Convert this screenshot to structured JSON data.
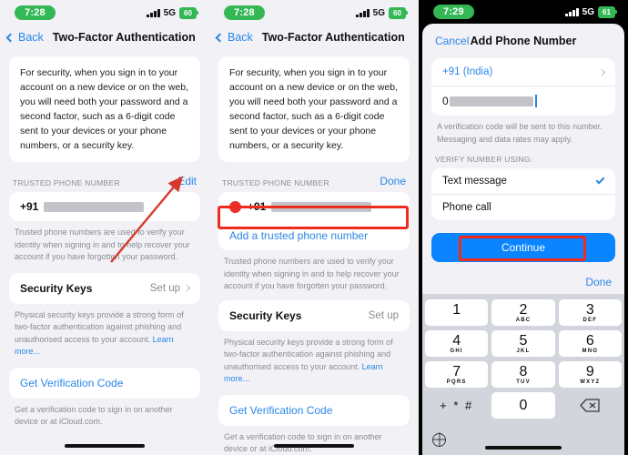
{
  "panels": [
    {
      "status": {
        "time": "7:28",
        "network": "5G",
        "battery": "60",
        "signal_icon": "signal-bars-icon"
      },
      "nav": {
        "back_label": "Back",
        "title": "Two-Factor Authentication"
      },
      "intro": "For security, when you sign in to your account on a new device or on the web, you will need both your password and a second factor, such as a 6-digit code sent to your devices or your phone numbers, or a security key.",
      "trusted": {
        "header": "TRUSTED PHONE NUMBER",
        "action": "Edit",
        "country_code": "+91",
        "footnote": "Trusted phone numbers are used to verify your identity when signing in and to help recover your account if you have forgotten your password."
      },
      "security_keys": {
        "title": "Security Keys",
        "action": "Set up",
        "footnote": "Physical security keys provide a strong form of two-factor authentication against phishing and unauthorised access to your account.",
        "learn_more": "Learn more..."
      },
      "verification": {
        "link": "Get Verification Code",
        "footnote": "Get a verification code to sign in on another device or at iCloud.com."
      },
      "annotation": {
        "type": "arrow",
        "color": "#d63a2e",
        "points_to": "Edit"
      }
    },
    {
      "status": {
        "time": "7:28",
        "network": "5G",
        "battery": "60",
        "signal_icon": "signal-bars-icon"
      },
      "nav": {
        "back_label": "Back",
        "title": "Two-Factor Authentication"
      },
      "intro": "For security, when you sign in to your account on a new device or on the web, you will need both your password and a second factor, such as a 6-digit code sent to your devices or your phone numbers, or a security key.",
      "trusted": {
        "header": "TRUSTED PHONE NUMBER",
        "action": "Done",
        "country_code": "+91",
        "add_label": "Add a trusted phone number",
        "footnote": "Trusted phone numbers are used to verify your identity when signing in and to help recover your account if you have forgotten your password."
      },
      "security_keys": {
        "title": "Security Keys",
        "action": "Set up",
        "footnote": "Physical security keys provide a strong form of two-factor authentication against phishing and unauthorised access to your account.",
        "learn_more": "Learn more..."
      },
      "verification": {
        "link": "Get Verification Code",
        "footnote": "Get a verification code to sign in on another device or at iCloud.com."
      },
      "annotation": {
        "type": "box",
        "color": "#ef2b1e",
        "highlights": "Add a trusted phone number"
      }
    },
    {
      "status": {
        "time": "7:29",
        "network": "5G",
        "battery": "61",
        "signal_icon": "signal-bars-icon"
      },
      "sheet": {
        "cancel_label": "Cancel",
        "title": "Add Phone Number",
        "country": "+91 (India)",
        "number_prefix": "0",
        "number_placeholder": "",
        "number_footnote": "A verification code will be sent to this number. Messaging and data rates may apply.",
        "verify_header": "VERIFY NUMBER USING:",
        "verify_options": [
          {
            "label": "Text message",
            "selected": true
          },
          {
            "label": "Phone call",
            "selected": false
          }
        ],
        "continue_label": "Continue",
        "keyboard_done": "Done"
      },
      "keypad": {
        "keys": [
          {
            "num": "1",
            "letters": ""
          },
          {
            "num": "2",
            "letters": "ABC"
          },
          {
            "num": "3",
            "letters": "DEF"
          },
          {
            "num": "4",
            "letters": "GHI"
          },
          {
            "num": "5",
            "letters": "JKL"
          },
          {
            "num": "6",
            "letters": "MNO"
          },
          {
            "num": "7",
            "letters": "PQRS"
          },
          {
            "num": "8",
            "letters": "TUV"
          },
          {
            "num": "9",
            "letters": "WXYZ"
          }
        ],
        "symbol_key": "+ * #",
        "zero_key": "0",
        "delete_icon": "backspace-icon",
        "globe_icon": "globe-icon"
      },
      "annotation": {
        "type": "box",
        "color": "#ef2b1e",
        "highlights": "Continue"
      }
    }
  ]
}
